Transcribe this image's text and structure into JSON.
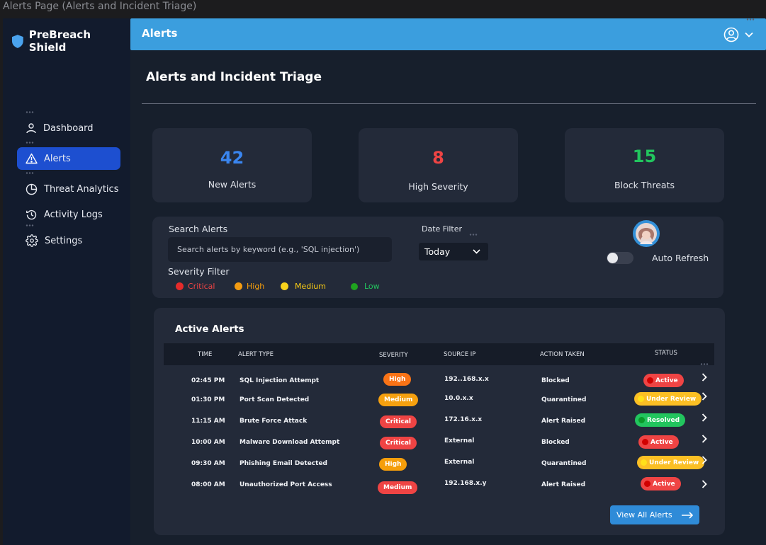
{
  "window": {
    "title": "Alerts Page (Alerts and Incident Triage)"
  },
  "sidebar": {
    "brand": "PreBreach Shield",
    "items": [
      {
        "label": "Dashboard",
        "icon": "user-icon"
      },
      {
        "label": "Alerts",
        "icon": "warning-icon",
        "active": true
      },
      {
        "label": "Threat Analytics",
        "icon": "pie-chart-icon"
      },
      {
        "label": "Activity Logs",
        "icon": "history-icon"
      },
      {
        "label": "Settings",
        "icon": "gear-icon"
      }
    ]
  },
  "header": {
    "title": "Alerts",
    "user_icon": "user-circle-icon"
  },
  "page": {
    "title": "Alerts and Incident Triage"
  },
  "stats": [
    {
      "value": "42",
      "label": "New Alerts",
      "color": "#3a86f0"
    },
    {
      "value": "8",
      "label": "High Severity",
      "color": "#ef4444"
    },
    {
      "value": "15",
      "label": "Block Threats",
      "color": "#22c55e"
    }
  ],
  "filters": {
    "search_label": "Search Alerts",
    "search_placeholder": "Search alerts by keyword (e.g., 'SQL injection')",
    "date_label": "Date Filter",
    "date_value": "Today",
    "auto_refresh_label": "Auto Refresh",
    "auto_refresh_on": false,
    "severity_label": "Severity Filter",
    "severity_options": [
      {
        "label": "Critical",
        "color": "#ef4444"
      },
      {
        "label": "High",
        "color": "#f59e0b"
      },
      {
        "label": "Medium",
        "color": "#facc15"
      },
      {
        "label": "Low",
        "color": "#22c55e"
      }
    ]
  },
  "alerts": {
    "title": "Active Alerts",
    "columns": [
      "TIME",
      "ALERT TYPE",
      "SEVERITY",
      "SOURCE IP",
      "ACTION TAKEN",
      "STATUS"
    ],
    "rows": [
      {
        "time": "02:45 PM",
        "type": "SQL Injection Attempt",
        "severity": "High",
        "sev_color": "#f97316",
        "ip": "192..168.x.x",
        "action": "Blocked",
        "status": "Active",
        "status_color": "#ef4444",
        "status_text": "#ffffff",
        "dot_color": "#d10000"
      },
      {
        "time": "01:30 PM",
        "type": "Port Scan Detected",
        "severity": "Medium",
        "sev_color": "#f5a00f",
        "ip": "10.0.x.x",
        "action": "Quarantined",
        "status": "Under Review",
        "status_color": "#fbbf24",
        "status_text": "#ffffff",
        "dot_color": "#ffe01a"
      },
      {
        "time": "11:15 AM",
        "type": "Brute Force Attack",
        "severity": "Critical",
        "sev_color": "#ef4444",
        "ip": "172.16.x.x",
        "action": "Alert Raised",
        "status": "Resolved",
        "status_color": "#22c55e",
        "status_text": "#ffffff",
        "dot_color": "#0a9a2a"
      },
      {
        "time": "10:00 AM",
        "type": "Malware Download Attempt",
        "severity": "Critical",
        "sev_color": "#ef4444",
        "ip": "External",
        "action": "Blocked",
        "status": "Active",
        "status_color": "#ef4444",
        "status_text": "#ffffff",
        "dot_color": "#d10000"
      },
      {
        "time": "09:30 AM",
        "type": "Phishing Email Detected",
        "severity": "High",
        "sev_color": "#f59e0b",
        "ip": "External",
        "action": "Quarantined",
        "status": "Under Review",
        "status_color": "#fbbf24",
        "status_text": "#ffffff",
        "dot_color": "#ffe01a"
      },
      {
        "time": "08:00 AM",
        "type": "Unauthorized Port Access",
        "severity": "Medium",
        "sev_color": "#ef4444",
        "ip": "192.168.x.y",
        "action": "Alert Raised",
        "status": "Active",
        "status_color": "#ef4444",
        "status_text": "#ffffff",
        "dot_color": "#d10000"
      }
    ],
    "view_all_label": "View All Alerts"
  }
}
